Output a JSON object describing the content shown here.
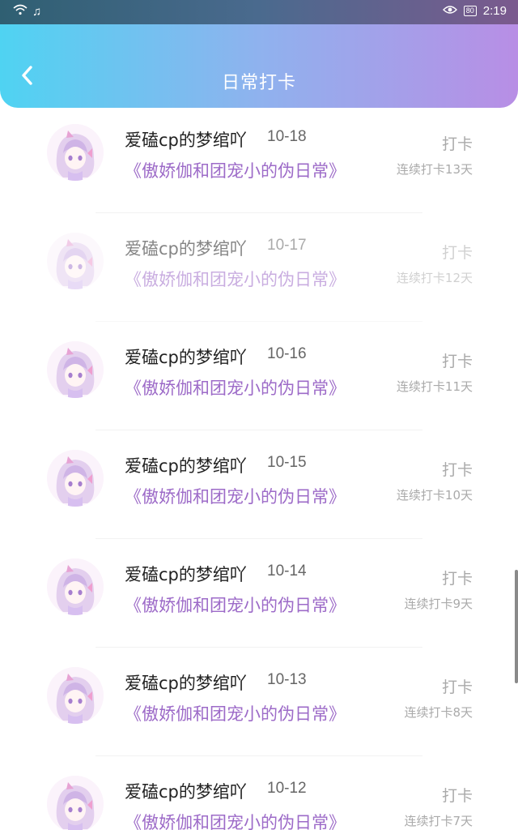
{
  "status_bar": {
    "time": "2:19",
    "battery": "80"
  },
  "header": {
    "title": "日常打卡"
  },
  "items": [
    {
      "user": "爱磕cp的梦绾吖",
      "date": "10-18",
      "book": "《傲娇伽和团宠小的伪日常》",
      "action": "打卡",
      "streak": "连续打卡13天"
    },
    {
      "user": "爱磕cp的梦绾吖",
      "date": "10-17",
      "book": "《傲娇伽和团宠小的伪日常》",
      "action": "打卡",
      "streak": "连续打卡12天"
    },
    {
      "user": "爱磕cp的梦绾吖",
      "date": "10-16",
      "book": "《傲娇伽和团宠小的伪日常》",
      "action": "打卡",
      "streak": "连续打卡11天"
    },
    {
      "user": "爱磕cp的梦绾吖",
      "date": "10-15",
      "book": "《傲娇伽和团宠小的伪日常》",
      "action": "打卡",
      "streak": "连续打卡10天"
    },
    {
      "user": "爱磕cp的梦绾吖",
      "date": "10-14",
      "book": "《傲娇伽和团宠小的伪日常》",
      "action": "打卡",
      "streak": "连续打卡9天"
    },
    {
      "user": "爱磕cp的梦绾吖",
      "date": "10-13",
      "book": "《傲娇伽和团宠小的伪日常》",
      "action": "打卡",
      "streak": "连续打卡8天"
    },
    {
      "user": "爱磕cp的梦绾吖",
      "date": "10-12",
      "book": "《傲娇伽和团宠小的伪日常》",
      "action": "打卡",
      "streak": "连续打卡7天"
    }
  ],
  "colors": {
    "header_start": "#4fd3f2",
    "header_end": "#b88ee5",
    "book_title": "#9d6bc8"
  }
}
